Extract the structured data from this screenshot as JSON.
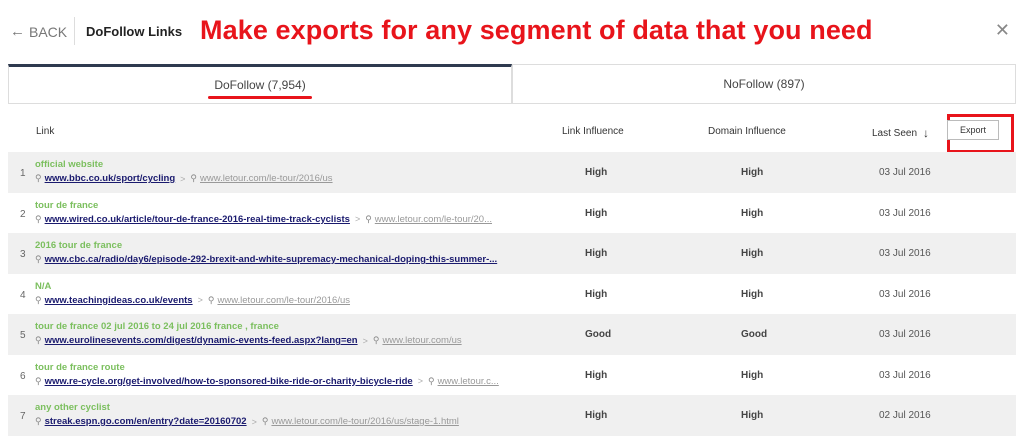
{
  "topbar": {
    "back_label": "BACK",
    "title": "DoFollow Links",
    "banner": "Make exports for any segment of data that you need",
    "close_glyph": "✕"
  },
  "tabs": [
    {
      "label": "DoFollow (7,954)",
      "active": true
    },
    {
      "label": "NoFollow (897)",
      "active": false
    }
  ],
  "table": {
    "headers": {
      "link": "Link",
      "link_influence": "Link Influence",
      "domain_influence": "Domain Influence",
      "last_seen": "Last Seen",
      "sort_glyph": "↓"
    },
    "export_label": "Export",
    "rows": [
      {
        "num": "1",
        "anchor": "official website",
        "source": "www.bbc.co.uk/sport/cycling",
        "target": "www.letour.com/le-tour/2016/us",
        "link_influence": "High",
        "domain_influence": "High",
        "last_seen": "03 Jul 2016"
      },
      {
        "num": "2",
        "anchor": "tour de france",
        "source": "www.wired.co.uk/article/tour-de-france-2016-real-time-track-cyclists",
        "target": "www.letour.com/le-tour/20...",
        "link_influence": "High",
        "domain_influence": "High",
        "last_seen": "03 Jul 2016"
      },
      {
        "num": "3",
        "anchor": "2016 tour de france",
        "source": "www.cbc.ca/radio/day6/episode-292-brexit-and-white-supremacy-mechanical-doping-this-summer-...",
        "target": "",
        "link_influence": "High",
        "domain_influence": "High",
        "last_seen": "03 Jul 2016"
      },
      {
        "num": "4",
        "anchor": "N/A",
        "source": "www.teachingideas.co.uk/events",
        "target": "www.letour.com/le-tour/2016/us",
        "link_influence": "High",
        "domain_influence": "High",
        "last_seen": "03 Jul 2016"
      },
      {
        "num": "5",
        "anchor": "tour de france 02 jul 2016 to 24 jul 2016 france , france",
        "source": "www.eurolinesevents.com/digest/dynamic-events-feed.aspx?lang=en",
        "target": "www.letour.com/us",
        "link_influence": "Good",
        "domain_influence": "Good",
        "last_seen": "03 Jul 2016"
      },
      {
        "num": "6",
        "anchor": "tour de france route",
        "source": "www.re-cycle.org/get-involved/how-to-sponsored-bike-ride-or-charity-bicycle-ride",
        "target": "www.letour.c...",
        "link_influence": "High",
        "domain_influence": "High",
        "last_seen": "03 Jul 2016"
      },
      {
        "num": "7",
        "anchor": "any other cyclist",
        "source": "streak.espn.go.com/en/entry?date=20160702",
        "target": "www.letour.com/le-tour/2016/us/stage-1.html",
        "link_influence": "High",
        "domain_influence": "High",
        "last_seen": "02 Jul 2016"
      }
    ]
  },
  "icons": {
    "search": "magnifier-icon",
    "chevron": "chevron-right-icon",
    "back": "arrow-left-icon",
    "close": "close-icon"
  },
  "colors": {
    "banner_red": "#e8141b",
    "anchor_green": "#7bbf5e",
    "link_navy": "#1a1a6e",
    "tab_active": "#2e3a4f"
  }
}
